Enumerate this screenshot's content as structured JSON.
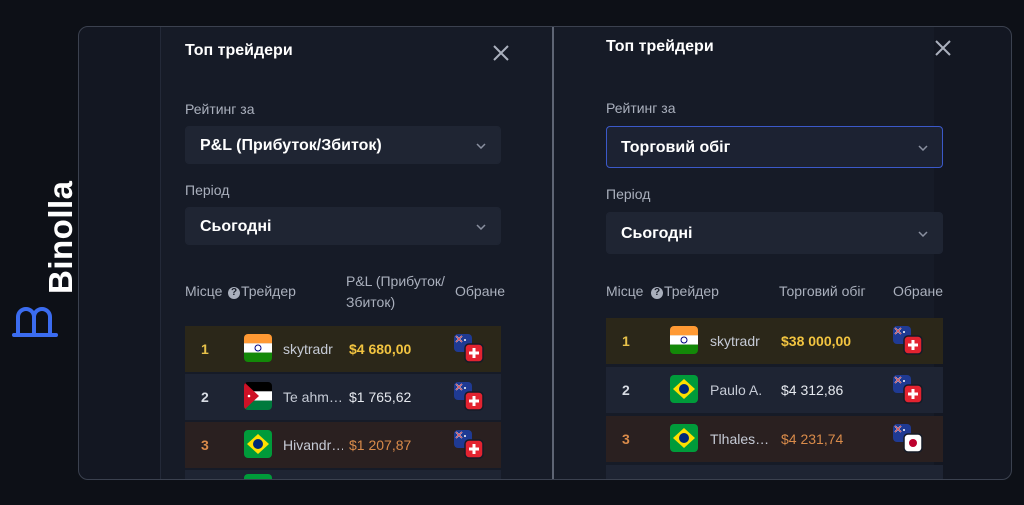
{
  "brand": {
    "name": "Binolla"
  },
  "panels": [
    {
      "title": "Топ трейдери",
      "rating_label": "Рейтинг за",
      "rating_value": "P&L (Прибуток/Збиток)",
      "period_label": "Період",
      "period_value": "Сьогодні",
      "columns": {
        "place": "Місце",
        "trader": "Трейдер",
        "metric": "P&L (Прибуток/ Збиток)",
        "favorites": "Обране"
      },
      "rows": [
        {
          "rank": "1",
          "flag": "india-flag",
          "name": "skytradr",
          "amount": "$4 680,00",
          "fav": "australia-switzerland"
        },
        {
          "rank": "2",
          "flag": "jordan-flag",
          "name": "Te ahm…",
          "amount": "$1 765,62",
          "fav": "australia-switzerland"
        },
        {
          "rank": "3",
          "flag": "brazil-flag",
          "name": "Hivandr…",
          "amount": "$1 207,87",
          "fav": "australia-switzerland"
        }
      ]
    },
    {
      "title": "Топ трейдери",
      "rating_label": "Рейтинг за",
      "rating_value": "Торговий обіг",
      "period_label": "Період",
      "period_value": "Сьогодні",
      "columns": {
        "place": "Місце",
        "trader": "Трейдер",
        "metric": "Торговий обіг",
        "favorites": "Обране"
      },
      "rows": [
        {
          "rank": "1",
          "flag": "india-flag",
          "name": "skytradr",
          "amount": "$38 000,00",
          "fav": "australia-switzerland"
        },
        {
          "rank": "2",
          "flag": "brazil-flag",
          "name": "Paulo A.",
          "amount": "$4 312,86",
          "fav": "australia-switzerland"
        },
        {
          "rank": "3",
          "flag": "brazil-flag",
          "name": "Tlhales…",
          "amount": "$4 231,74",
          "fav": "australia-japan"
        }
      ]
    }
  ],
  "colors": {
    "gold": "#f2c440",
    "bronze": "#d98b4a",
    "accent_border": "#3b59c9",
    "brand_blue": "#3b6cf0"
  }
}
